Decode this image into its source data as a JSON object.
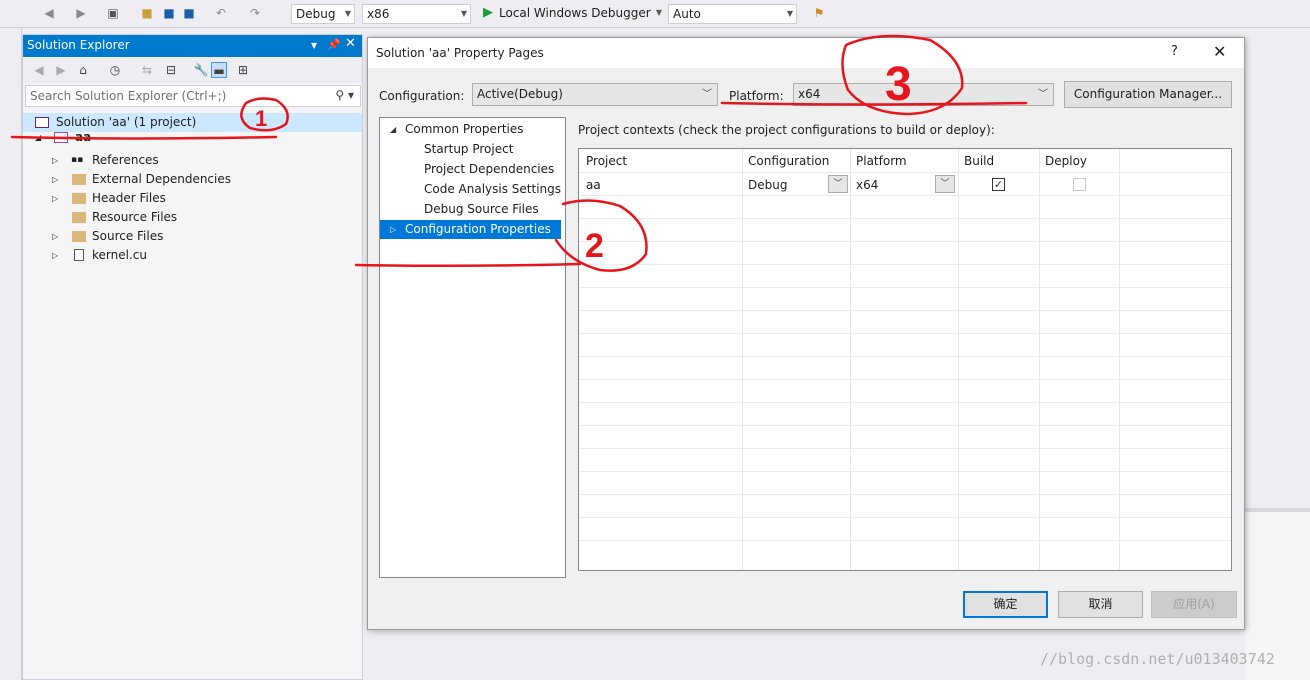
{
  "toolbar": {
    "config_value": "Debug",
    "platform_value": "x86",
    "debugger_label": "Local Windows Debugger",
    "auto_value": "Auto"
  },
  "solution_explorer": {
    "title": "Solution Explorer",
    "search_placeholder": "Search Solution Explorer (Ctrl+;)",
    "tree": {
      "solution_label": "Solution 'aa' (1 project)",
      "project_label": "aa",
      "items": [
        "References",
        "External Dependencies",
        "Header Files",
        "Resource Files",
        "Source Files",
        "kernel.cu"
      ]
    }
  },
  "dialog": {
    "title": "Solution 'aa' Property Pages",
    "help_glyph": "?",
    "close_glyph": "✕",
    "configuration_label": "Configuration:",
    "configuration_value": "Active(Debug)",
    "platform_label": "Platform:",
    "platform_value": "x64",
    "config_manager_button": "Configuration Manager...",
    "nav": {
      "common_properties": "Common Properties",
      "startup_project": "Startup Project",
      "project_dependencies": "Project Dependencies",
      "code_analysis_settings": "Code Analysis Settings",
      "debug_source_files": "Debug Source Files",
      "configuration_properties": "Configuration Properties"
    },
    "contexts_label": "Project contexts (check the project configurations to build or deploy):",
    "grid": {
      "headers": [
        "Project",
        "Configuration",
        "Platform",
        "Build",
        "Deploy"
      ],
      "row": {
        "project": "aa",
        "configuration": "Debug",
        "platform": "x64",
        "build": true,
        "deploy": false
      }
    },
    "ok_button": "确定",
    "cancel_button": "取消",
    "apply_button": "应用(A)"
  },
  "watermark": "//blog.csdn.net/u013403742",
  "annotations": [
    "1",
    "2",
    "3"
  ],
  "colors": {
    "accent": "#007acc",
    "selection": "#0078d7",
    "annotation_red": "#e8141c"
  }
}
